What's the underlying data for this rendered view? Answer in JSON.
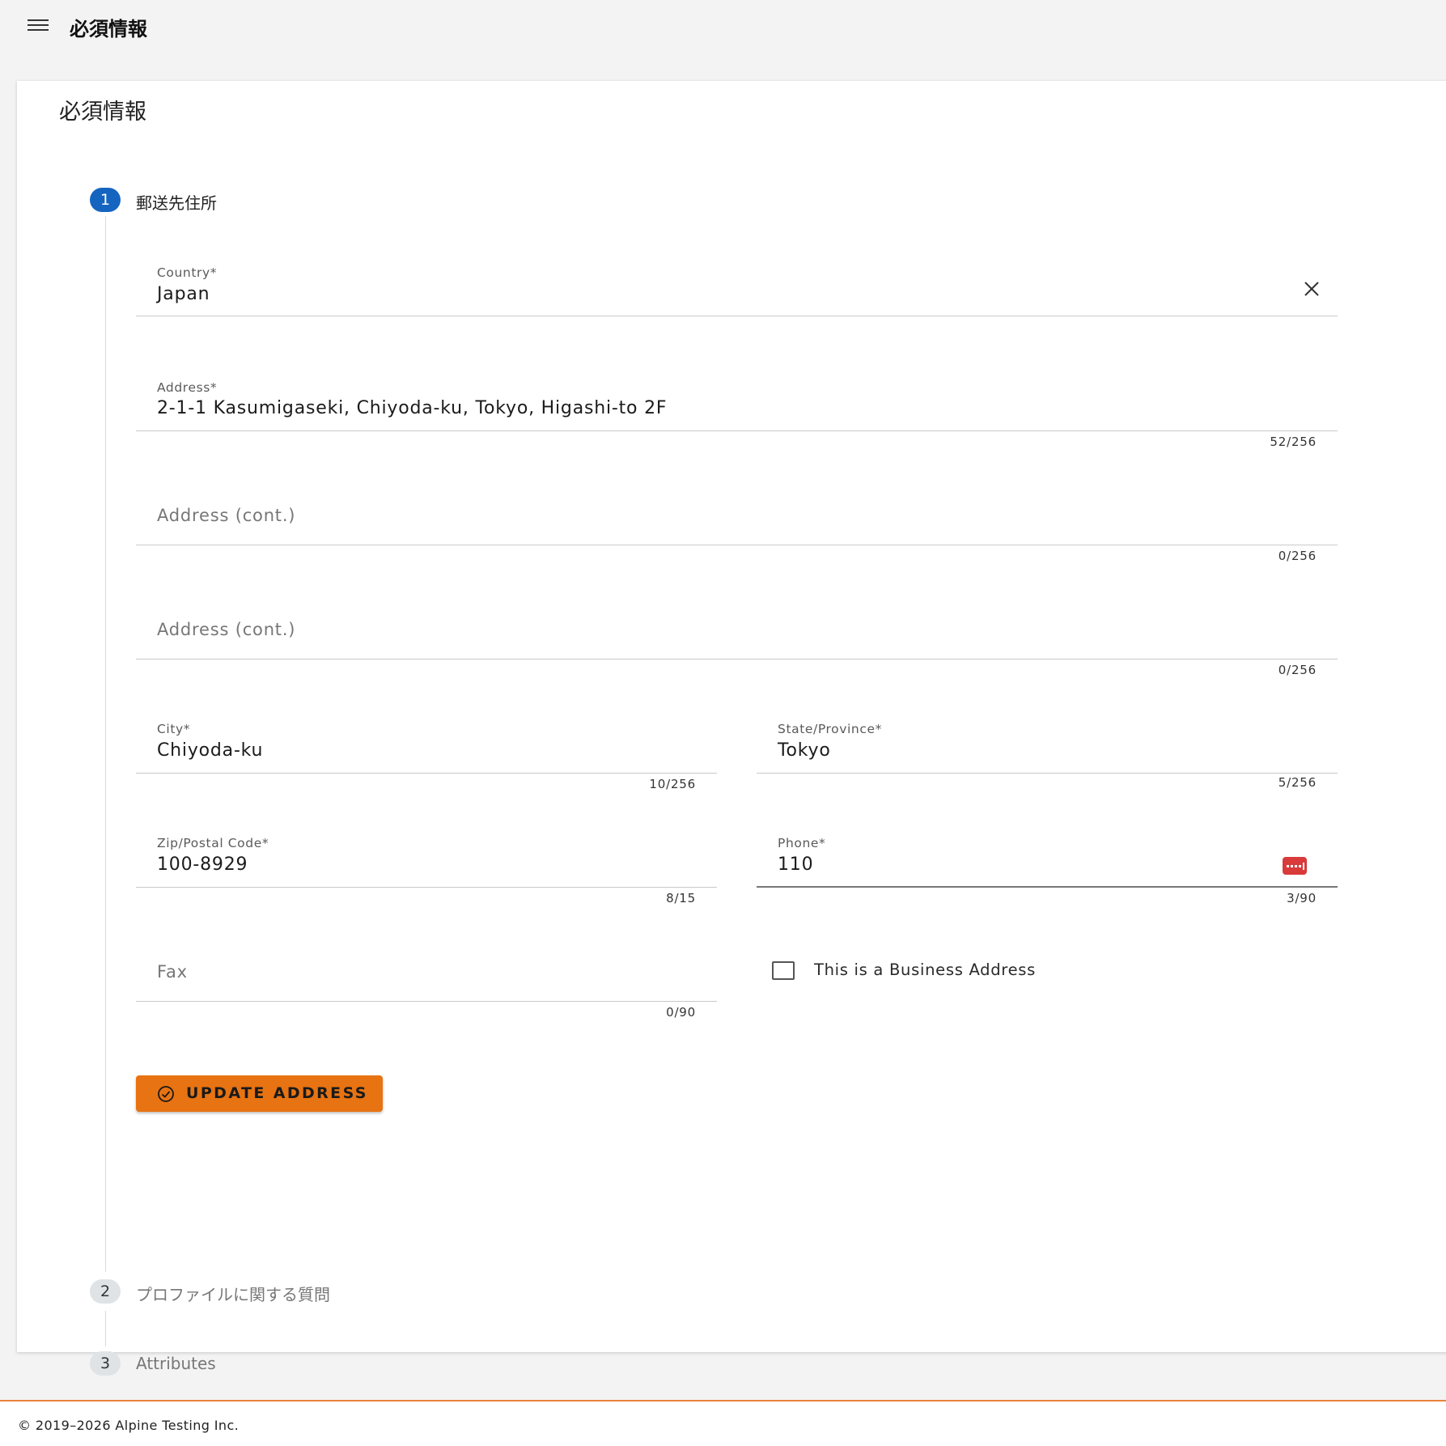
{
  "header": {
    "title": "必須情報"
  },
  "card": {
    "title": "必須情報"
  },
  "steps": [
    {
      "number": "1",
      "label": "郵送先住所",
      "state": "active"
    },
    {
      "number": "2",
      "label": "プロファイルに関する質問",
      "state": "inactive"
    },
    {
      "number": "3",
      "label": "Attributes",
      "state": "inactive"
    }
  ],
  "form": {
    "country": {
      "label": "Country*",
      "value": "Japan"
    },
    "address1": {
      "label": "Address*",
      "value": "2-1-1 Kasumigaseki, Chiyoda-ku, Tokyo, Higashi-to 2F",
      "counter": "52/256"
    },
    "address2": {
      "placeholder": "Address (cont.)",
      "counter": "0/256"
    },
    "address3": {
      "placeholder": "Address (cont.)",
      "counter": "0/256"
    },
    "city": {
      "label": "City*",
      "value": "Chiyoda-ku",
      "counter": "10/256"
    },
    "state": {
      "label": "State/Province*",
      "value": "Tokyo",
      "counter": "5/256"
    },
    "zip": {
      "label": "Zip/Postal Code*",
      "value": "100-8929",
      "counter": "8/15"
    },
    "phone": {
      "label": "Phone*",
      "value": "110",
      "counter": "3/90"
    },
    "fax": {
      "placeholder": "Fax",
      "counter": "0/90"
    },
    "business_checkbox": {
      "label": "This is a Business Address",
      "checked": false
    },
    "update_button": {
      "label": "UPDATE ADDRESS"
    }
  },
  "footer": {
    "copyright": "© 2019–2026 Alpine Testing Inc."
  },
  "colors": {
    "accent_orange": "#e87312",
    "step_active_blue": "#1565c0",
    "phone_badge_red": "#d93a3a"
  }
}
